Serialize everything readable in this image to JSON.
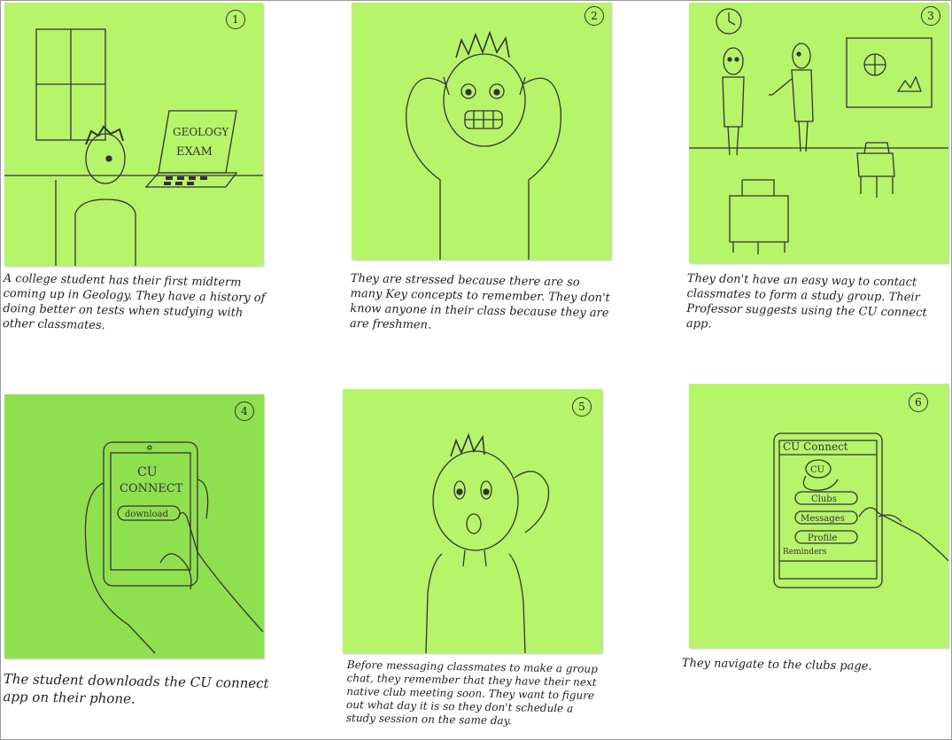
{
  "panels": [
    {
      "number": "1",
      "caption": "A college student has their first midterm coming up in Geology. They have a history of doing better on tests when studying with other classmates.",
      "laptop_text_1": "GEOLOGY",
      "laptop_text_2": "EXAM"
    },
    {
      "number": "2",
      "caption": "They are stressed because there are so many Key concepts to remember. They don't know anyone in their class because they are are freshmen."
    },
    {
      "number": "3",
      "caption": "They don't have an easy way to contact classmates to form a study group. Their Professor suggests using the CU connect app."
    },
    {
      "number": "4",
      "caption": "The student downloads the CU connect app on their phone.",
      "phone_title_1": "CU",
      "phone_title_2": "CONNECT",
      "phone_button": "download"
    },
    {
      "number": "5",
      "caption": "Before messaging classmates to make a group chat, they remember that they have their next native club meeting soon. They want to figure out what day it is so they don't schedule a study session on the same day."
    },
    {
      "number": "6",
      "caption": "They navigate to the clubs page.",
      "app_header": "CU Connect",
      "app_logo": "CU",
      "menu": [
        "Clubs",
        "Messages",
        "Profile"
      ],
      "reminder": "Reminders"
    }
  ],
  "colors": {
    "note": "#b6f46a",
    "note_dark": "#8fe04f",
    "ink": "#333333"
  }
}
